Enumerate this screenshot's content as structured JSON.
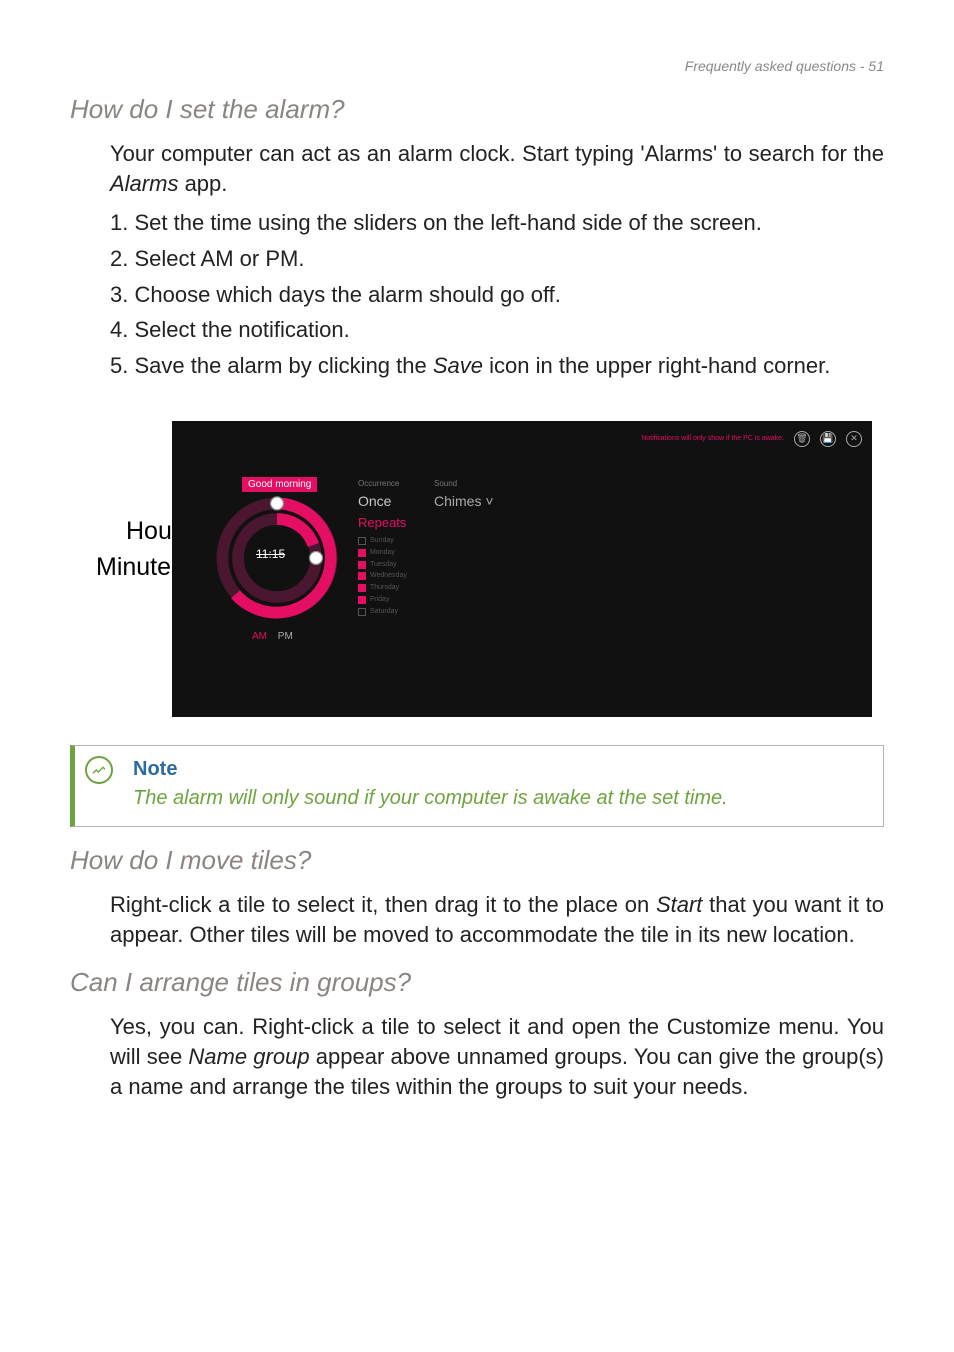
{
  "header": {
    "text": "Frequently asked questions - 51"
  },
  "sections": {
    "alarm": {
      "heading": "How do I set the alarm?",
      "intro_pre": "Your computer can act as an alarm clock. Start typing 'Alarms' to search for the ",
      "intro_italic": "Alarms",
      "intro_post": " app.",
      "steps": {
        "n1": "1.",
        "s1": "Set the time using the sliders on the left-hand side of the screen.",
        "n2": "2.",
        "s2": "Select AM or PM.",
        "n3": "3.",
        "s3": "Choose which days the alarm should go off.",
        "n4": "4.",
        "s4": "Select the notification.",
        "n5": "5.",
        "s5_pre": "Save the alarm by clicking the ",
        "s5_italic": "Save",
        "s5_post": " icon in the upper right-hand corner."
      }
    },
    "move": {
      "heading": "How do I move tiles?",
      "text_pre": "Right-click a tile to select it, then drag it to the place on ",
      "text_italic": "Start",
      "text_post": " that you want it to appear. Other tiles will be moved to accommodate the tile in its new location."
    },
    "groups": {
      "heading": "Can I arrange tiles in groups?",
      "text_pre": "Yes, you can. Right-click a tile to select it and open the Customize menu. You will see ",
      "text_italic": "Name group",
      "text_post": " appear above unnamed groups. You can give the group(s) a name and arrange the tiles within the groups to suit your needs."
    }
  },
  "figure": {
    "callouts": {
      "delete": "Delete",
      "save": "Save",
      "hour": "Hour",
      "minutes": "Minutes"
    },
    "screenshot": {
      "title": "Good morning",
      "time": "11:15",
      "am": "AM",
      "pm": "PM",
      "occurrence_label": "Occurrence",
      "once": "Once",
      "repeats": "Repeats",
      "sound_label": "Sound",
      "sound_value": "Chimes ˅",
      "top_text": "Notifications will only show if the PC is awake.",
      "days": {
        "sun": "Sunday",
        "mon": "Monday",
        "tue": "Tuesday",
        "wed": "Wednesday",
        "thu": "Thursday",
        "fri": "Friday",
        "sat": "Saturday"
      }
    }
  },
  "note": {
    "title": "Note",
    "text": "The alarm will only sound if your computer is awake at the set time."
  }
}
